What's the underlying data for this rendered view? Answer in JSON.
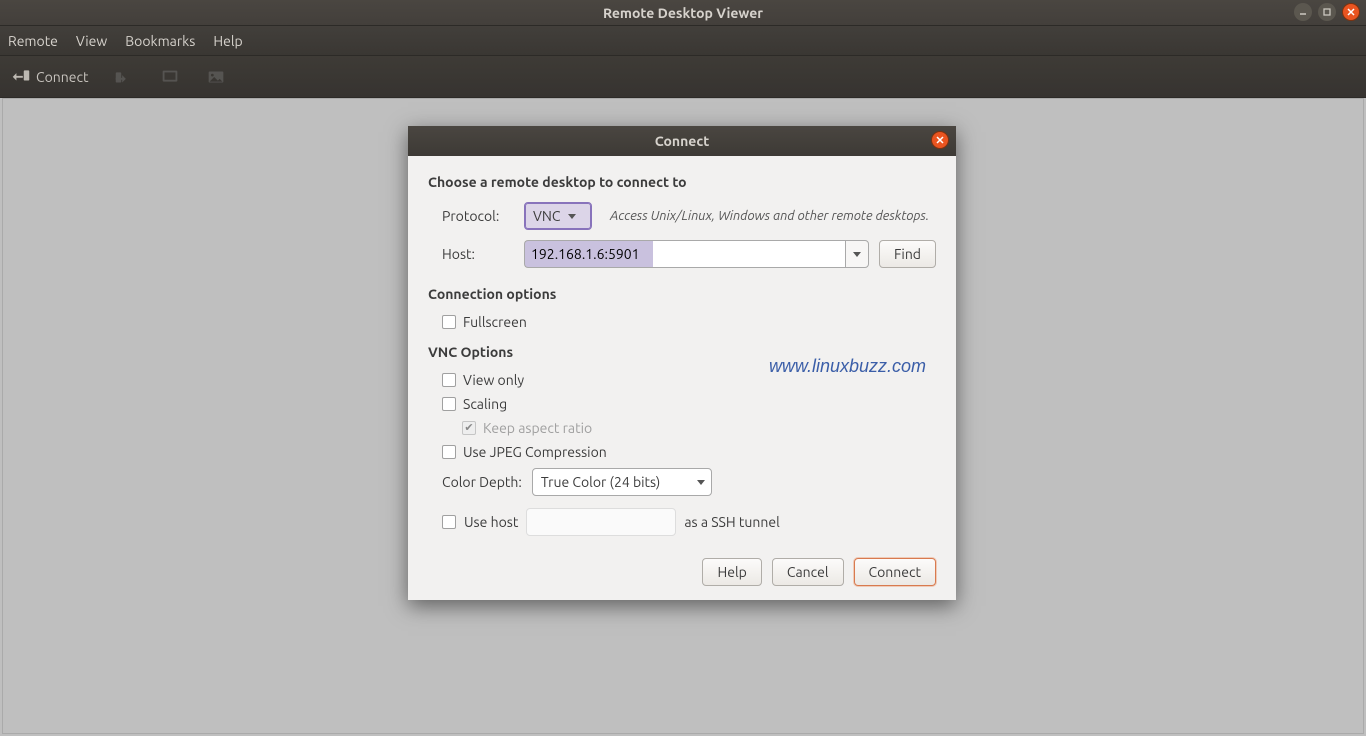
{
  "window": {
    "title": "Remote Desktop Viewer"
  },
  "menu": {
    "remote": "Remote",
    "view": "View",
    "bookmarks": "Bookmarks",
    "help": "Help"
  },
  "toolbar": {
    "connect_label": "Connect"
  },
  "dialog": {
    "title": "Connect",
    "heading": "Choose a remote desktop to connect to",
    "protocol_label": "Protocol:",
    "protocol_value": "VNC",
    "protocol_hint": "Access Unix/Linux, Windows and other remote desktops.",
    "host_label": "Host:",
    "host_value": "192.168.1.6:5901",
    "find_btn": "Find",
    "conn_options_heading": "Connection options",
    "fullscreen": "Fullscreen",
    "vnc_options_heading": "VNC Options",
    "view_only": "View only",
    "scaling": "Scaling",
    "keep_aspect": "Keep aspect ratio",
    "use_jpeg": "Use JPEG Compression",
    "color_depth_label": "Color Depth:",
    "color_depth_value": "True Color (24 bits)",
    "use_host_ssh": "Use host",
    "ssh_suffix": "as a SSH tunnel",
    "btn_help": "Help",
    "btn_cancel": "Cancel",
    "btn_connect": "Connect"
  },
  "watermark": "www.linuxbuzz.com"
}
